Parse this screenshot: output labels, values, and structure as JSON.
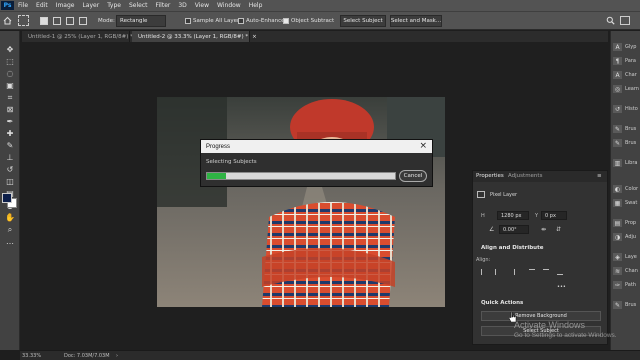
{
  "menubar": {
    "logo": "Ps",
    "items": [
      "File",
      "Edit",
      "Image",
      "Layer",
      "Type",
      "Select",
      "Filter",
      "3D",
      "View",
      "Window",
      "Help"
    ]
  },
  "options": {
    "mode_label": "Mode:",
    "mode_value": "Rectangle",
    "sample_all_layers": "Sample All Layers",
    "sample_all_layers_checked": false,
    "auto_enhance": "Auto-Enhance",
    "auto_enhance_checked": false,
    "object_subtract": "Object Subtract",
    "object_subtract_checked": true,
    "select_subject": "Select Subject",
    "select_and_mask": "Select and Mask..."
  },
  "tabs": [
    {
      "label": "Untitled-1 @ 25% (Layer 1, RGB/8#) *",
      "close": "×",
      "active": false
    },
    {
      "label": "Untitled-2 @ 33.3% (Layer 1, RGB/8#) *",
      "close": "×",
      "active": true
    }
  ],
  "progress_dialog": {
    "title": "Progress",
    "close": "×",
    "status": "Selecting Subjects",
    "progress_fraction": 0.1,
    "cancel": "Cancel"
  },
  "properties": {
    "tab_properties": "Properties",
    "tab_adjustments": "Adjustments",
    "layer_type": "Pixel Layer",
    "h_label": "H",
    "h_value": "1280 px",
    "y_label": "Y",
    "y_value": "0 px",
    "angle_value": "0.00°",
    "align_title": "Align and Distribute",
    "align_label": "Align:",
    "more": "•••",
    "quick_actions_title": "Quick Actions",
    "remove_background": "Remove Background",
    "select_subject": "Select Subject"
  },
  "right_panels": [
    "Glyp",
    "Para",
    "Char",
    "Learn",
    "Histo",
    "Brus",
    "Brus",
    "Libra",
    "Color",
    "Swat",
    "Prop",
    "Adju",
    "Laye",
    "Chan",
    "Path",
    "Brus"
  ],
  "statusbar": {
    "zoom": "33.33%",
    "doc": "Doc: 7.03M/7.03M"
  },
  "watermark": {
    "line1": "Activate Windows",
    "line2": "Go to Settings to activate Windows."
  },
  "colors": {
    "accent_green": "#2fb344",
    "foreground_swatch": "#0d1f4a",
    "background_swatch": "#ffffff"
  }
}
